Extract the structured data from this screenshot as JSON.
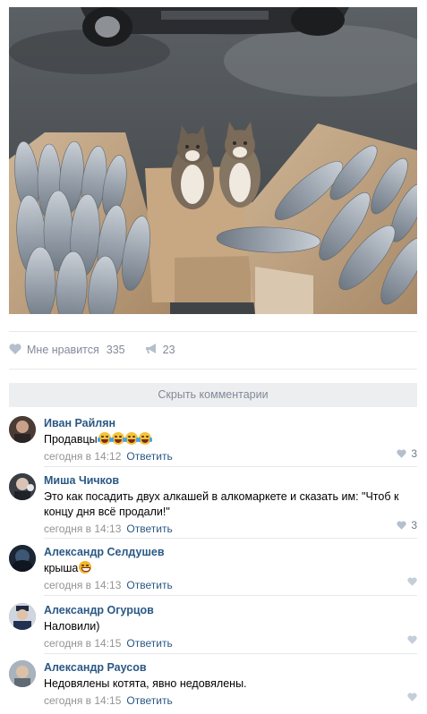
{
  "post": {
    "photo_alt": "photo-cats-and-dried-fish",
    "likes": {
      "label": "Мне нравится",
      "count": "335",
      "icon": "heart-icon"
    },
    "shares": {
      "count": "23",
      "icon": "megaphone-icon"
    }
  },
  "comments_toggle": {
    "label": "Скрыть комментарии"
  },
  "colors": {
    "link": "#2a5885",
    "muted": "#939393",
    "accent_bg": "#edeef0"
  },
  "comments": [
    {
      "author": "Иван Райлян",
      "text": "Продавцы",
      "emoji_count": 4,
      "time": "сегодня в 14:12",
      "reply": "Ответить",
      "likes": "3"
    },
    {
      "author": "Миша Чичков",
      "text": "Это как посадить двух алкашей в алкомаркете и сказать им: \"Чтоб к концу дня всё продали!\"",
      "emoji_count": 0,
      "time": "сегодня в 14:13",
      "reply": "Ответить",
      "likes": "3"
    },
    {
      "author": "Александр Селдушев",
      "text": "крыша",
      "emoji_count": 1,
      "time": "сегодня в 14:13",
      "reply": "Ответить",
      "likes": ""
    },
    {
      "author": "Александр Огурцов",
      "text": "Наловили)",
      "emoji_count": 0,
      "time": "сегодня в 14:15",
      "reply": "Ответить",
      "likes": ""
    },
    {
      "author": "Александр Раусов",
      "text": "Недовялены котята, явно недовялены.",
      "emoji_count": 0,
      "time": "сегодня в 14:15",
      "reply": "Ответить",
      "likes": ""
    }
  ]
}
